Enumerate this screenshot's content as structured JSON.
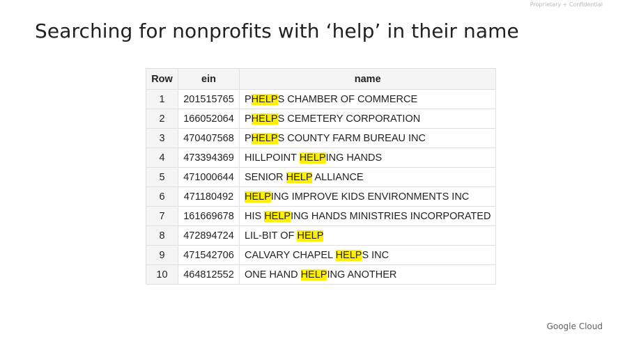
{
  "header": {
    "confidential": "Proprietary + Confidential",
    "title": "Searching for nonprofits with ‘help’ in their name"
  },
  "table": {
    "columns": [
      "Row",
      "ein",
      "name"
    ],
    "highlight_color": "#fff000",
    "rows": [
      {
        "row": "1",
        "ein": "201515765",
        "name": [
          [
            "P",
            false
          ],
          [
            "HELP",
            true
          ],
          [
            "S CHAMBER OF COMMERCE",
            false
          ]
        ]
      },
      {
        "row": "2",
        "ein": "166052064",
        "name": [
          [
            "P",
            false
          ],
          [
            "HELP",
            true
          ],
          [
            "S CEMETERY CORPORATION",
            false
          ]
        ]
      },
      {
        "row": "3",
        "ein": "470407568",
        "name": [
          [
            "P",
            false
          ],
          [
            "HELP",
            true
          ],
          [
            "S COUNTY FARM BUREAU INC",
            false
          ]
        ]
      },
      {
        "row": "4",
        "ein": "473394369",
        "name": [
          [
            "HILLPOINT ",
            false
          ],
          [
            "HELP",
            true
          ],
          [
            "ING HANDS",
            false
          ]
        ]
      },
      {
        "row": "5",
        "ein": "471000644",
        "name": [
          [
            "SENIOR ",
            false
          ],
          [
            "HELP",
            true
          ],
          [
            " ALLIANCE",
            false
          ]
        ]
      },
      {
        "row": "6",
        "ein": "471180492",
        "name": [
          [
            "HELP",
            true
          ],
          [
            "ING IMPROVE KIDS ENVIRONMENTS INC",
            false
          ]
        ]
      },
      {
        "row": "7",
        "ein": "161669678",
        "name": [
          [
            "HIS ",
            false
          ],
          [
            "HELP",
            true
          ],
          [
            "ING HANDS MINISTRIES INCORPORATED",
            false
          ]
        ]
      },
      {
        "row": "8",
        "ein": "472894724",
        "name": [
          [
            "LIL-BIT OF ",
            false
          ],
          [
            "HELP",
            true
          ]
        ]
      },
      {
        "row": "9",
        "ein": "471542706",
        "name": [
          [
            "CALVARY CHAPEL ",
            false
          ],
          [
            "HELP",
            true
          ],
          [
            "S INC",
            false
          ]
        ]
      },
      {
        "row": "10",
        "ein": "464812552",
        "name": [
          [
            "ONE HAND ",
            false
          ],
          [
            "HELP",
            true
          ],
          [
            "ING ANOTHER",
            false
          ]
        ]
      }
    ]
  },
  "footer": {
    "brand": "Google Cloud"
  }
}
